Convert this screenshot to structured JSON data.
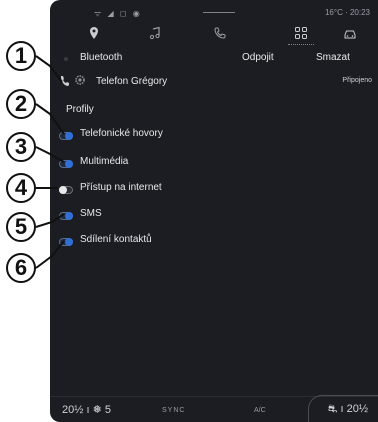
{
  "status_bar": {
    "left_icons": "ᯤ ◢ ◻ ◉",
    "right_text": "16°C · 20:23"
  },
  "tabs": [
    {
      "icon": "location-pin-icon"
    },
    {
      "icon": "music-note-icon"
    },
    {
      "icon": "phone-icon"
    },
    {
      "icon": "apps-grid-icon",
      "selected": true
    },
    {
      "icon": "car-icon"
    }
  ],
  "header": {
    "bluetooth_label": "Bluetooth",
    "disconnect_label": "Odpojit",
    "delete_label": "Smazat"
  },
  "device": {
    "name": "Telefon Grégory",
    "status": "Připojeno"
  },
  "profiles": {
    "title": "Profily",
    "items": [
      {
        "label": "Telefonické hovory",
        "enabled": true
      },
      {
        "label": "Multimédia",
        "enabled": true
      },
      {
        "label": "Přístup na internet",
        "enabled": false
      },
      {
        "label": "SMS",
        "enabled": true
      },
      {
        "label": "Sdílení kontaktů",
        "enabled": true
      }
    ]
  },
  "bottom_bar": {
    "left_temp": "20½  ı  ❅ 5",
    "sync_label": "SYNC",
    "ac_label": "A/C",
    "right_temp": "⛐  ı  20½"
  },
  "callouts": [
    "1",
    "2",
    "3",
    "4",
    "5",
    "6"
  ],
  "colors": {
    "screen_bg": "#1b1d22",
    "accent": "#2f6fd6",
    "text": "#e8e8ea"
  }
}
